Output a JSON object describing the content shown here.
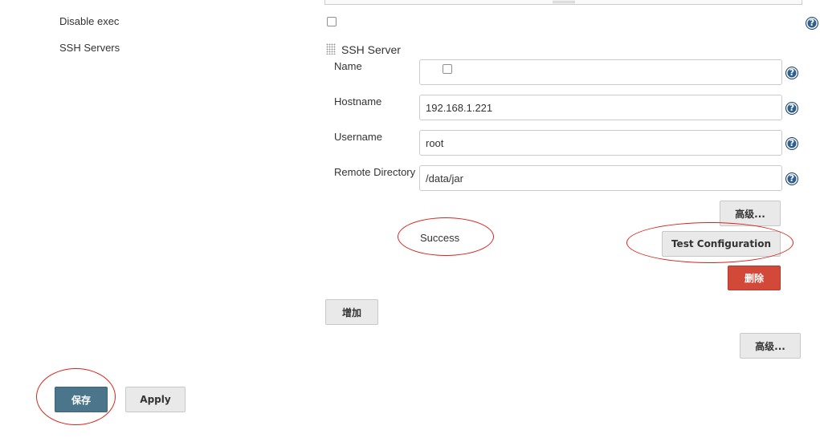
{
  "left_labels": {
    "disable_exec": "Disable exec",
    "ssh_servers": "SSH Servers"
  },
  "ssh_server": {
    "section_title": "SSH Server",
    "fields": {
      "name": {
        "label": "Name",
        "value": ""
      },
      "hostname": {
        "label": "Hostname",
        "value": "192.168.1.221"
      },
      "username": {
        "label": "Username",
        "value": "root"
      },
      "remote_directory": {
        "label": "Remote Directory",
        "value": "/data/jar"
      }
    },
    "advanced_label": "高级...",
    "status_text": "Success",
    "test_configuration_label": "Test Configuration",
    "delete_label": "删除"
  },
  "add_label": "增加",
  "advanced_label_bottom": "高级...",
  "footer": {
    "save_label": "保存",
    "apply_label": "Apply"
  },
  "icons": {
    "help": "help-icon",
    "drag": "drag-handle-icon",
    "help_glyph": "?"
  },
  "colors": {
    "help_blue": "#2f5f8c",
    "danger_red": "#d24939",
    "primary_blue": "#4b758b",
    "annotation_red": "#d9241c"
  }
}
